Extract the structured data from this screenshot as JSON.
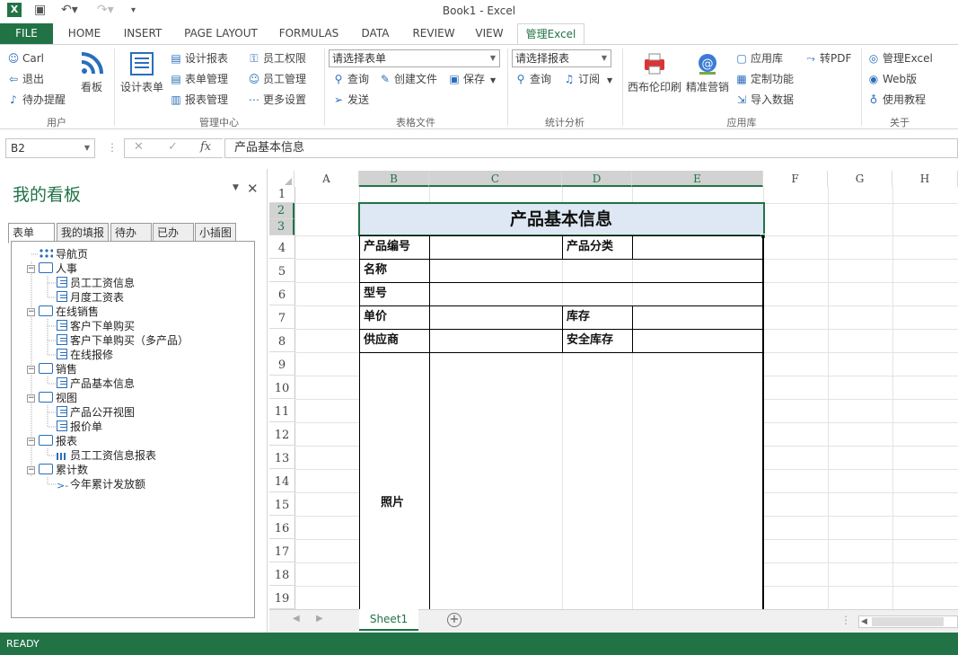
{
  "window": {
    "title": "Book1 - Excel"
  },
  "tabs": [
    "FILE",
    "HOME",
    "INSERT",
    "PAGE LAYOUT",
    "FORMULAS",
    "DATA",
    "REVIEW",
    "VIEW",
    "管理Excel"
  ],
  "ribbon": {
    "user": {
      "items": [
        "Carl",
        "退出",
        "待办提醒"
      ],
      "kanban": "看板",
      "label": "用户"
    },
    "mgmt": {
      "design": "设计表单",
      "items": [
        "设计报表",
        "表单管理",
        "报表管理",
        "员工权限",
        "员工管理",
        "更多设置"
      ],
      "label": "管理中心"
    },
    "forms": {
      "select_placeholder": "请选择表单",
      "items": [
        "查询",
        "创建文件",
        "保存",
        "发送"
      ],
      "label": "表格文件"
    },
    "stats": {
      "select_placeholder": "请选择报表",
      "items": [
        "查询",
        "订阅"
      ],
      "label": "统计分析"
    },
    "apps": {
      "big": [
        "西布伦印刷",
        "精准营销"
      ],
      "items": [
        "应用库",
        "定制功能",
        "导入数据",
        "转PDF"
      ],
      "label": "应用库"
    },
    "about": {
      "items": [
        "管理Excel",
        "Web版",
        "使用教程"
      ],
      "label": "关于"
    }
  },
  "formula_bar": {
    "namebox": "B2",
    "fx": "fx",
    "content": "产品基本信息"
  },
  "panel": {
    "title": "我的看板",
    "tabs": [
      "表单",
      "我的填报",
      "待办",
      "已办",
      "小插图"
    ],
    "tree": {
      "nav": "导航页",
      "hr": "人事",
      "hr1": "员工工资信息",
      "hr2": "月度工资表",
      "online": "在线销售",
      "on1": "客户下单购买",
      "on2": "客户下单购买（多产品）",
      "on3": "在线报修",
      "sales": "销售",
      "s1": "产品基本信息",
      "view": "视图",
      "v1": "产品公开视图",
      "v2": "报价单",
      "report": "报表",
      "r1": "员工工资信息报表",
      "cum": "累计数",
      "c1": "今年累计发放额"
    }
  },
  "sheet": {
    "columns": [
      "A",
      "B",
      "C",
      "D",
      "E",
      "F",
      "G",
      "H"
    ],
    "rows": [
      "1",
      "2",
      "3",
      "4",
      "5",
      "6",
      "7",
      "8",
      "9",
      "10",
      "11",
      "12",
      "13",
      "14",
      "15",
      "16",
      "17",
      "18",
      "19"
    ],
    "form_title": "产品基本信息",
    "labels": {
      "code": "产品编号",
      "category": "产品分类",
      "name": "名称",
      "model": "型号",
      "price": "单价",
      "stock": "库存",
      "supplier": "供应商",
      "safe_stock": "安全库存",
      "photo": "照片"
    },
    "tab": "Sheet1"
  },
  "status": "READY"
}
